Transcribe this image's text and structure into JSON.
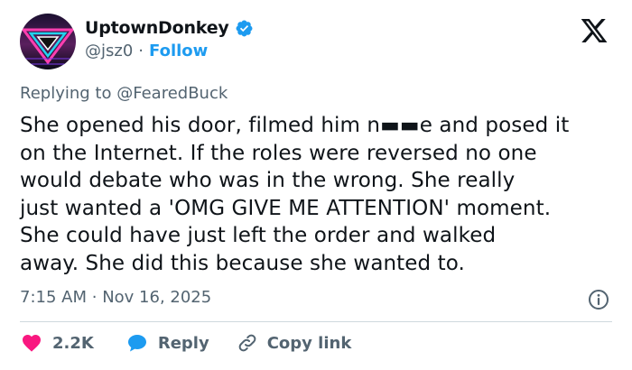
{
  "author": {
    "display_name": "UptownDonkey",
    "handle": "@jsz0",
    "separator": "·",
    "follow_label": "Follow"
  },
  "reply": {
    "prefix": "Replying to",
    "mention": "@FearedBuck"
  },
  "tweet": {
    "text": "She opened his door, filmed him n▬▬e and posed it\non the Internet. If the roles were reversed no one\nwould debate who was in the wrong. She really\njust wanted a 'OMG GIVE ME ATTENTION' moment.\nShe could have just left the order and walked\naway. She did this because she wanted to."
  },
  "meta": {
    "time": "7:15 AM",
    "separator": "·",
    "date": "Nov 16, 2025"
  },
  "actions": {
    "likes": "2.2K",
    "reply_label": "Reply",
    "copy_label": "Copy link"
  },
  "colors": {
    "like": "#f91880",
    "reply": "#1d9bf0",
    "follow": "#1d9bf0",
    "verified": "#1d9bf0"
  }
}
